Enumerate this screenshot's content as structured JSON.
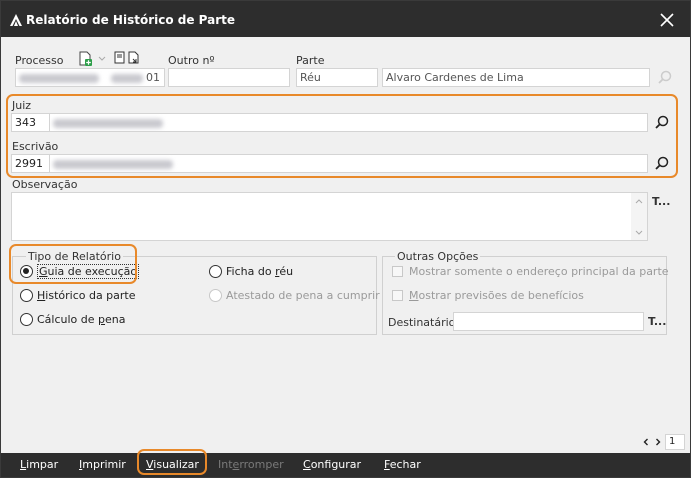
{
  "window": {
    "title": "Relatório de Histórico de Parte"
  },
  "processo": {
    "label": "Processo",
    "value_suffix": "01"
  },
  "outro": {
    "label": "Outro nº",
    "value": ""
  },
  "parte": {
    "label": "Parte",
    "tipo": "Réu",
    "nome": "Alvaro Cardenes de Lima"
  },
  "juiz": {
    "label": "Juiz",
    "codigo": "343"
  },
  "escrivao": {
    "label": "Escrivão",
    "codigo": "2991"
  },
  "observacao": {
    "label": "Observação",
    "side_button": "T..."
  },
  "tipo_relatorio": {
    "legend": "Tipo de Relatório",
    "options": [
      {
        "first": "G",
        "rest": "uia de execução",
        "selected": true,
        "enabled": true
      },
      {
        "first": "H",
        "rest": "istórico da parte",
        "selected": false,
        "enabled": true
      },
      {
        "pre": "Cálculo de ",
        "first": "p",
        "rest": "ena",
        "selected": false,
        "enabled": true
      },
      {
        "pre": "Ficha do ",
        "first": "r",
        "rest": "éu",
        "selected": false,
        "enabled": true
      },
      {
        "label": "Atestado de pena a cumprir",
        "selected": false,
        "enabled": false
      }
    ]
  },
  "outras_opcoes": {
    "legend": "Outras Opções",
    "chk1": "Mostrar somente o endereço principal da parte",
    "chk2_first": "M",
    "chk2_rest": "ostrar previsões de benefícios",
    "destinatario_label": "Destinatário",
    "destinatario_value": "",
    "side_button": "T..."
  },
  "pager": {
    "page": "1"
  },
  "toolbar": {
    "limpar_first": "L",
    "limpar_rest": "impar",
    "imprimir_first": "I",
    "imprimir_rest": "mprimir",
    "visualizar_first": "V",
    "visualizar_rest": "isualizar",
    "interromper_pre": "Int",
    "interromper_first": "e",
    "interromper_rest": "rromper",
    "configurar_first": "C",
    "configurar_rest": "onfigurar",
    "fechar_first": "F",
    "fechar_rest": "echar"
  },
  "colors": {
    "highlight": "#e8892a",
    "titlebar": "#2d2d2d"
  }
}
